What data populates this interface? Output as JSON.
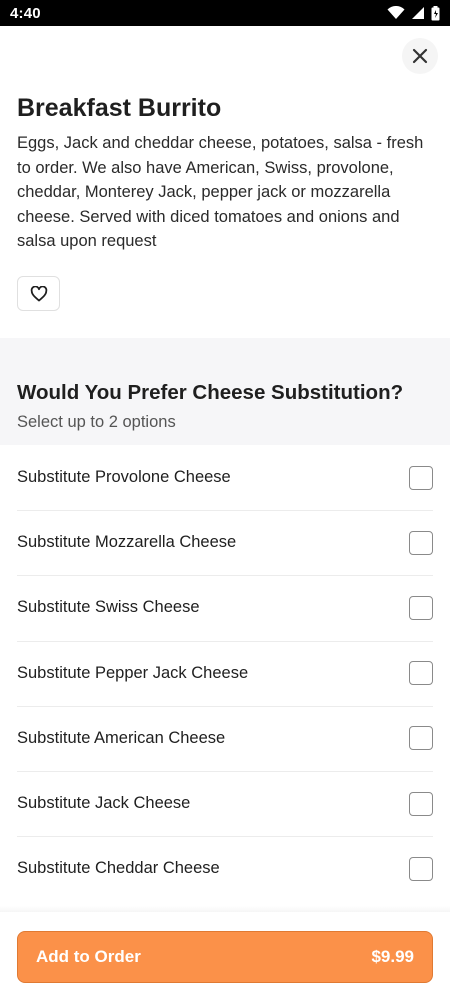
{
  "status_bar": {
    "time": "4:40",
    "icons": [
      "wifi-icon",
      "signal-icon",
      "battery-icon"
    ]
  },
  "header": {
    "close_icon": "close-icon"
  },
  "item": {
    "title": "Breakfast Burrito",
    "description": "Eggs, Jack and cheddar cheese, potatoes, salsa - fresh to order. We also have American, Swiss, provolone, cheddar, Monterey Jack, pepper jack or mozzarella cheese. Served with diced tomatoes and onions and salsa upon request",
    "favorite_icon": "heart-icon"
  },
  "section": {
    "title": "Would You Prefer Cheese Substitution?",
    "subtitle": "Select up to 2 options",
    "options": [
      {
        "label": "Substitute Provolone Cheese",
        "checked": false
      },
      {
        "label": "Substitute Mozzarella Cheese",
        "checked": false
      },
      {
        "label": "Substitute Swiss Cheese",
        "checked": false
      },
      {
        "label": "Substitute Pepper Jack Cheese",
        "checked": false
      },
      {
        "label": "Substitute American Cheese",
        "checked": false
      },
      {
        "label": "Substitute Jack Cheese",
        "checked": false
      },
      {
        "label": "Substitute Cheddar Cheese",
        "checked": false
      }
    ]
  },
  "footer": {
    "add_label": "Add to Order",
    "price": "$9.99"
  },
  "colors": {
    "accent": "#fb9149",
    "section_bg": "#f6f6f8"
  }
}
